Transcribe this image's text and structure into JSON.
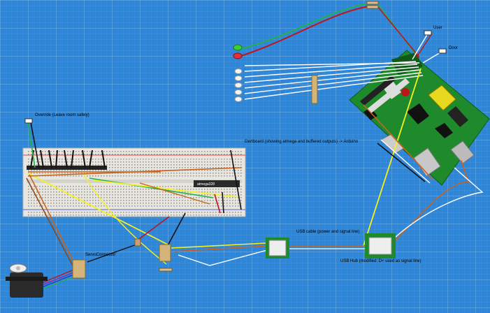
{
  "labels": {
    "override": "Override (Leave room safely)",
    "gertboard": "Gertboard (showing atmega and buffered outputs) -> Arduino",
    "atmega_chip": "atmega328",
    "usb_cable": "USB cable (power and signal line)",
    "usb_hub": "USB Hub (modified: D+ used as signal line)",
    "servo_connector": "ServoConnector",
    "user": "User",
    "door": "Door"
  },
  "colors": {
    "background": "#2e86d8",
    "breadboard": "#e8e6e0",
    "pcb_green": "#1f8a2c",
    "wire_green": "#22b14c",
    "wire_red": "#c0141c",
    "wire_yellow": "#f5f01e",
    "wire_orange": "#c8641e",
    "wire_black": "#111111",
    "wire_white": "#ffffff"
  }
}
